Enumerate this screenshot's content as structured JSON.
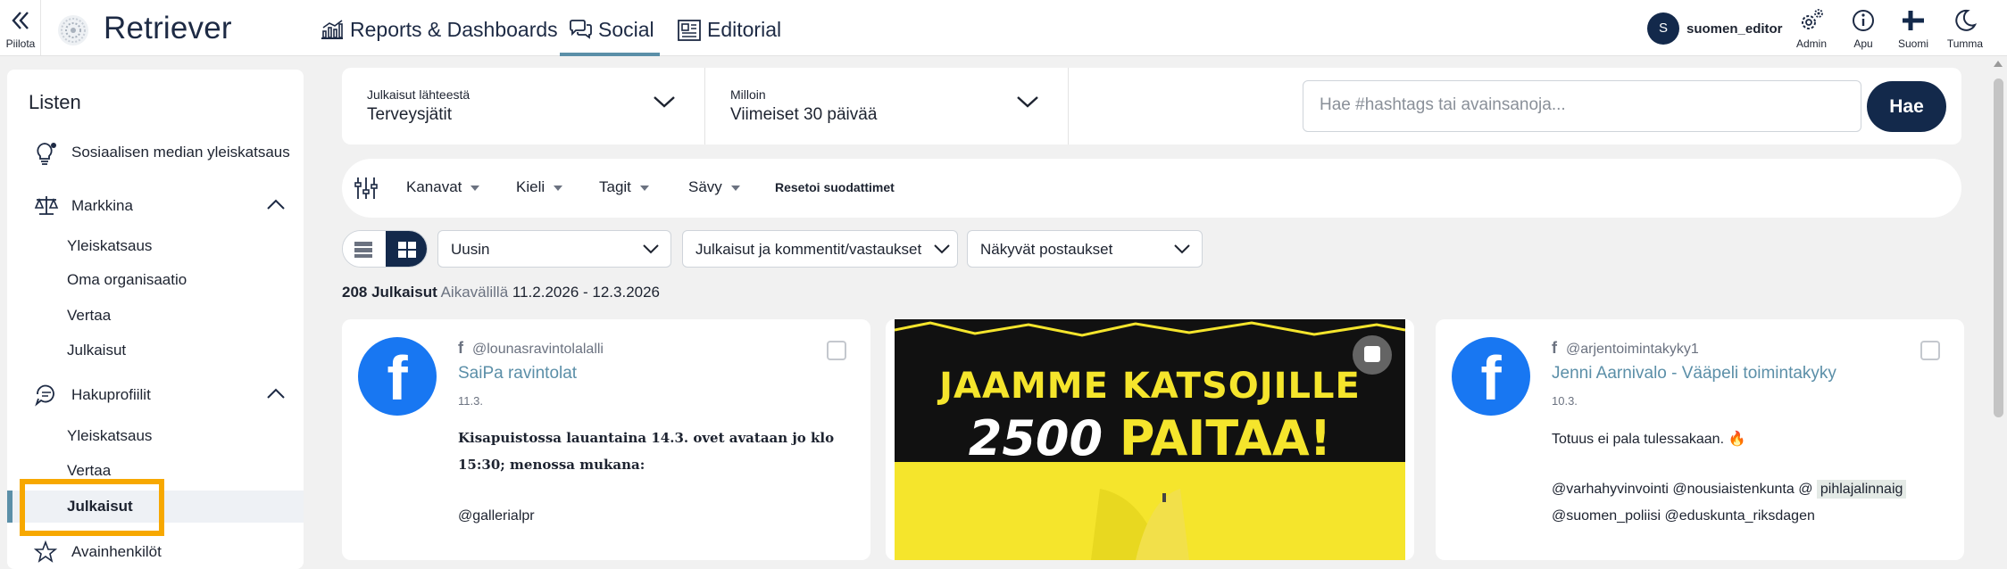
{
  "app": {
    "hide_label": "Piilota",
    "logo_text": "Retriever"
  },
  "nav": [
    {
      "label": "Reports & Dashboards"
    },
    {
      "label": "Social"
    },
    {
      "label": "Editorial"
    }
  ],
  "user": {
    "initial": "S",
    "name": "suomen_editor"
  },
  "tools": [
    {
      "label": "Admin",
      "icon": "gear-icon"
    },
    {
      "label": "Apu",
      "icon": "info-icon"
    },
    {
      "label": "Suomi",
      "icon": "finnish-flag-icon"
    },
    {
      "label": "Tumma",
      "icon": "moon-icon"
    }
  ],
  "sidebar": {
    "title": "Listen",
    "overview": "Sosiaalisen median yleiskatsaus",
    "market": {
      "label": "Markkina",
      "items": [
        "Yleiskatsaus",
        "Oma organisaatio",
        "Vertaa",
        "Julkaisut"
      ]
    },
    "profiles": {
      "label": "Hakuprofiilit",
      "items": [
        "Yleiskatsaus",
        "Vertaa",
        "Julkaisut"
      ]
    },
    "next": "Avainhenkilöt"
  },
  "filters": {
    "source_label": "Julkaisut lähteestä",
    "source_value": "Terveysjätit",
    "when_label": "Milloin",
    "when_value": "Viimeiset 30 päivää",
    "search_placeholder": "Hae #hashtags tai avainsanoja...",
    "search_button": "Hae"
  },
  "filter_bar": {
    "channels": "Kanavat",
    "language": "Kieli",
    "tags": "Tagit",
    "tone": "Sävy",
    "reset": "Resetoi suodattimet"
  },
  "controls": {
    "sort": "Uusin",
    "type": "Julkaisut ja kommentit/vastaukset",
    "visible": "Näkyvät postaukset"
  },
  "summary": {
    "count": "208 Julkaisut",
    "range_label": "Aikavälillä",
    "range": "11.2.2026 - 12.3.2026"
  },
  "posts": [
    {
      "handle": "@lounasravintolalalli",
      "name": "SaiPa ravintolat",
      "date": "11.3.",
      "lines": [
        "Kisapuistossa lauantaina 14.3. ovet avataan jo klo",
        "15:30; menossa mukana:",
        "@gallerialpr"
      ]
    },
    {
      "image_line1": "JAAMME KATSOJILLE",
      "image_line2_num": "2500",
      "image_line2_word": "PAITAA!"
    },
    {
      "handle": "@arjentoimintakyky1",
      "name": "Jenni Aarnivalo - Vääpeli toimintakyky",
      "date": "10.3.",
      "line1": "Totuus ei pala tulessakaan. 🔥",
      "line2_pre": "@varhahyvinvointi @nousiaistenkunta @",
      "line2_tag": "pihlajalinnaig",
      "line3": "@suomen_poliisi @eduskunta_riksdagen"
    }
  ],
  "colors": {
    "brand_navy": "#13294b",
    "accent": "#5b8fa8",
    "highlight": "#f7a800",
    "facebook": "#1877f2",
    "poster_yellow": "#f5e52c"
  }
}
